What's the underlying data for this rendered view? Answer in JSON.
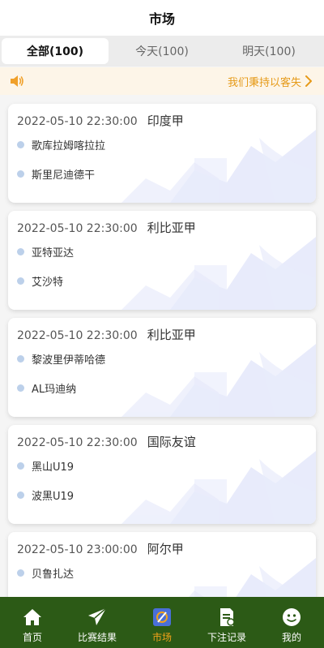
{
  "header": {
    "title": "市场"
  },
  "tabs": [
    {
      "label": "全部(100)",
      "active": true
    },
    {
      "label": "今天(100)",
      "active": false
    },
    {
      "label": "明天(100)",
      "active": false
    }
  ],
  "notice": {
    "icon": "speaker-icon",
    "text": "我们秉持以客失",
    "arrow": "chevron-right-icon",
    "color": "#e69a18"
  },
  "matches": [
    {
      "time": "2022-05-10 22:30:00",
      "league": "印度甲",
      "home": "歌库拉姆喀拉拉",
      "away": "斯里尼迪德干"
    },
    {
      "time": "2022-05-10 22:30:00",
      "league": "利比亚甲",
      "home": "亚特亚达",
      "away": "艾沙特"
    },
    {
      "time": "2022-05-10 22:30:00",
      "league": "利比亚甲",
      "home": "黎波里伊蒂哈德",
      "away": "AL玛迪纳"
    },
    {
      "time": "2022-05-10 22:30:00",
      "league": "国际友谊",
      "home": "黑山U19",
      "away": "波黑U19"
    },
    {
      "time": "2022-05-10 23:00:00",
      "league": "阿尔甲",
      "home": "贝鲁扎达",
      "away": ""
    }
  ],
  "tabbar": [
    {
      "label": "首页",
      "icon": "home-icon",
      "active": false
    },
    {
      "label": "比赛结果",
      "icon": "send-icon",
      "active": false
    },
    {
      "label": "市场",
      "icon": "market-icon",
      "active": true
    },
    {
      "label": "下注记录",
      "icon": "record-icon",
      "active": false
    },
    {
      "label": "我的",
      "icon": "profile-icon",
      "active": false
    }
  ],
  "colors": {
    "tabbar_bg": "#2c5a16",
    "accent": "#f3a21a",
    "notice_bg": "#fdf5e8"
  }
}
